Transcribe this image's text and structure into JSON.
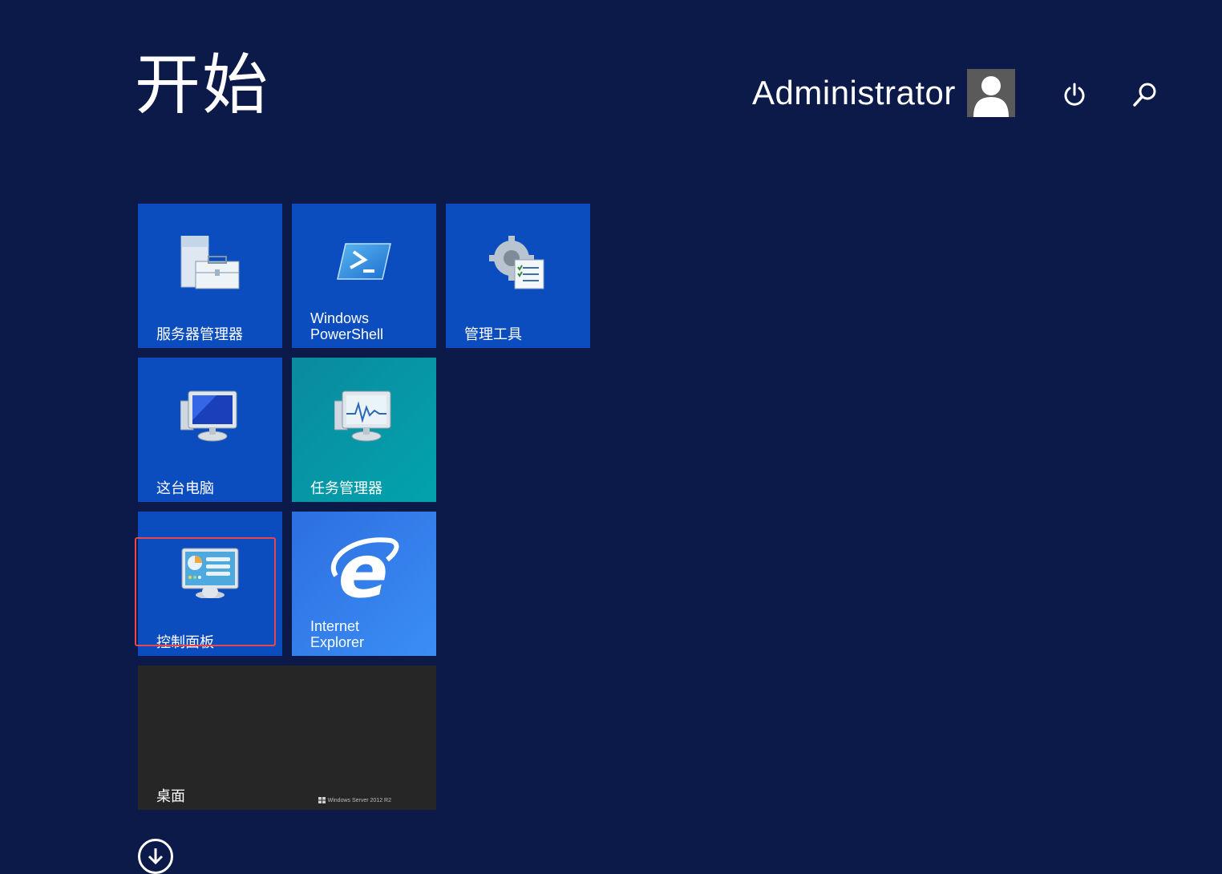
{
  "header": {
    "title": "开始",
    "user_name": "Administrator",
    "icons": {
      "avatar": "user-avatar-icon",
      "power": "power-icon",
      "search": "search-icon"
    }
  },
  "tiles": [
    {
      "label": "服务器管理器",
      "icon": "server-manager-icon",
      "color": "#0b4cbf"
    },
    {
      "label_line1": "Windows",
      "label_line2": "PowerShell",
      "icon": "powershell-icon",
      "color": "#0b4cbf"
    },
    {
      "label": "管理工具",
      "icon": "admin-tools-icon",
      "color": "#0b4cbf"
    },
    {
      "label": "这台电脑",
      "icon": "computer-icon",
      "color": "#0b4cbf"
    },
    {
      "label": "任务管理器",
      "icon": "task-manager-icon",
      "color": "#02a3ad"
    },
    {
      "label": "控制面板",
      "icon": "control-panel-icon",
      "color": "#0b4cbf",
      "highlighted": true
    },
    {
      "label_line1": "Internet",
      "label_line2": "Explorer",
      "icon": "internet-explorer-icon",
      "color": "#3b8ef5"
    },
    {
      "label": "桌面",
      "icon": "desktop-tile",
      "color": "#262626",
      "watermark": "Windows Server 2012 R2"
    }
  ],
  "footer": {
    "icon": "arrow-down-circle-icon"
  },
  "colors": {
    "background": "#0b1a48",
    "highlight_border": "#e8474e"
  }
}
